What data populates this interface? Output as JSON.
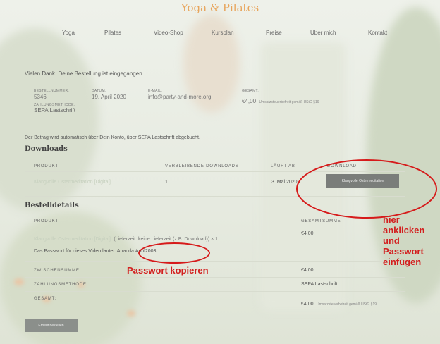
{
  "site": {
    "title": "Yoga & Pilates"
  },
  "nav": {
    "items": [
      "Yoga",
      "Pilates",
      "Video-Shop",
      "Kursplan",
      "Preise",
      "Über mich",
      "Kontakt"
    ]
  },
  "order": {
    "thanks": "Vielen Dank. Deine Bestellung ist eingegangen.",
    "number_label": "BESTELLNUMMER:",
    "number": "5346",
    "date_label": "DATUM:",
    "date": "19. April 2020",
    "email_label": "E-MAIL:",
    "email": "info@party-and-more.org",
    "total_label": "GESAMT:",
    "total": "€4,00",
    "total_note": "Umsatzsteuerbefreit gemäß UStG §19",
    "method_label": "ZAHLUNGSMETHODE:",
    "method": "SEPA Lastschrift",
    "sepa_note": "Der Betrag wird automatisch über Dein Konto, über SEPA Lastschrift abgebucht."
  },
  "downloads": {
    "heading": "Downloads",
    "col_product": "PRODUKT",
    "col_remaining": "VERBLEIBENDE DOWNLOADS",
    "col_expires": "LÄUFT AB",
    "col_download": "DOWNLOAD",
    "row": {
      "product": "Klangvolle Ostermeditation [Digital]",
      "remaining": "1",
      "expires": "3. Mai 2020",
      "button": "Klangvolle Ostermeditation"
    }
  },
  "details": {
    "heading": "Bestelldetails",
    "col_product": "PRODUKT",
    "col_total": "GESAMTSUMME",
    "item_link": "Klangvolle Ostermeditation [Digital]",
    "item_rest": "(Lieferzeit: keine Lieferzeit (z.B. Download)) × 1",
    "item_price": "€4,00",
    "password_prefix": "Das Passwort für dieses Video lautet:",
    "password": "Ananda.April2003",
    "subtotal_label": "ZWISCHENSUMME:",
    "subtotal": "€4,00",
    "method_label": "ZAHLUNGSMETHODE:",
    "method": "SEPA Lastschrift",
    "total_label": "GESAMT:",
    "total": "€4,00",
    "total_note": "Umsatzsteuerbefreit gemäß UStG §19",
    "reorder_button": "Erneut bestellen"
  },
  "annotations": {
    "copy_password": "Passwort kopieren",
    "click_here": [
      "hier",
      "anklicken",
      "und",
      "Passwort",
      "einfügen"
    ],
    "color": "#d31f1f"
  }
}
